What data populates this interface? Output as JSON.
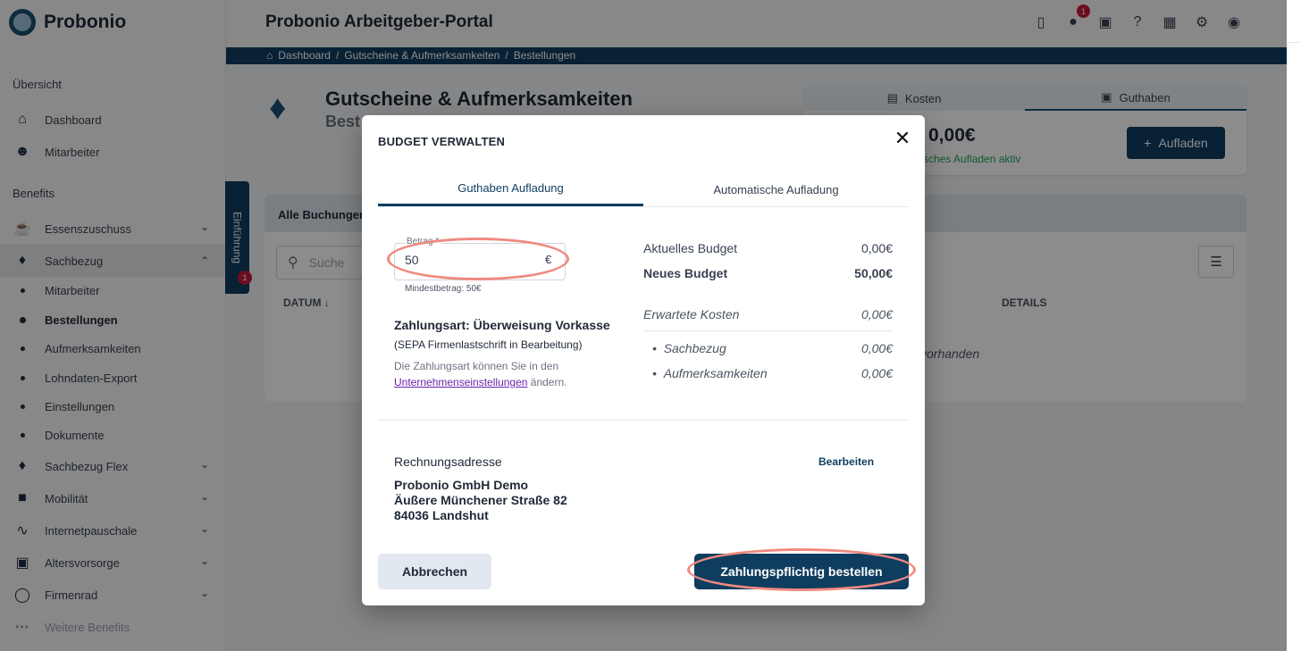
{
  "app": {
    "logo_text": "Probonio",
    "title": "Probonio Arbeitgeber-Portal",
    "notification_count": "1"
  },
  "breadcrumb": [
    "Dashboard",
    "Gutscheine & Aufmerksamkeiten",
    "Bestellungen"
  ],
  "sidebar": {
    "section_overview": "Übersicht",
    "section_benefits": "Benefits",
    "items": {
      "dashboard": "Dashboard",
      "employees": "Mitarbeiter",
      "meal": "Essenszuschuss",
      "sachbezug": "Sachbezug",
      "sub_employees": "Mitarbeiter",
      "sub_orders": "Bestellungen",
      "sub_gifts": "Aufmerksamkeiten",
      "sub_payroll": "Lohndaten-Export",
      "sub_settings": "Einstellungen",
      "sub_documents": "Dokumente",
      "sachbezug_flex": "Sachbezug Flex",
      "mobility": "Mobilität",
      "internet": "Internetpauschale",
      "pension": "Altersvorsorge",
      "bike": "Firmenrad",
      "more": "Weitere Benefits"
    }
  },
  "main": {
    "title": "Gutscheine & Aufmerksamkeiten",
    "subtitle": "Best",
    "budget_tabs": [
      "Kosten",
      "Guthaben"
    ],
    "budget_amount": "0,00€",
    "budget_status": "tisches Aufladen aktiv",
    "topup_label": "Aufladen",
    "bookings_tab": "Alle Buchungen",
    "search_placeholder": "Suche",
    "col_date": "DATUM",
    "col_details": "DETAILS",
    "empty_text": "vorhanden",
    "intro_label": "Einführung",
    "intro_badge": "1"
  },
  "modal": {
    "title": "BUDGET VERWALTEN",
    "tabs": [
      "Guthaben Aufladung",
      "Automatische Aufladung"
    ],
    "amount_label": "Betrag *",
    "amount_value": "50",
    "amount_unit": "€",
    "amount_hint": "Mindestbetrag: 50€",
    "payment_title": "Zahlungsart: Überweisung Vorkasse",
    "payment_sub": "(SEPA Firmenlastschrift in Bearbeitung)",
    "payment_note_pre": "Die Zahlungsart können Sie in den",
    "payment_link": "Unternehmenseinstellungen",
    "payment_note_post": " ändern.",
    "summary": {
      "current_label": "Aktuelles Budget",
      "current_value": "0,00€",
      "new_label": "Neues Budget",
      "new_value": "50,00€",
      "expected_label": "Erwartete Kosten",
      "expected_value": "0,00€",
      "sachbezug_label": "Sachbezug",
      "sachbezug_value": "0,00€",
      "gifts_label": "Aufmerksamkeiten",
      "gifts_value": "0,00€"
    },
    "billing_label": "Rechnungsadresse",
    "billing_edit": "Bearbeiten",
    "address": [
      "Probonio GmbH Demo",
      "Äußere Münchener Straße 82",
      "84036 Landshut"
    ],
    "cancel_label": "Abbrechen",
    "order_label": "Zahlungspflichtig bestellen"
  },
  "colors": {
    "primary": "#0f3d5f",
    "highlight": "#f08a80",
    "badge": "#c5193b",
    "success": "#22a35a"
  }
}
